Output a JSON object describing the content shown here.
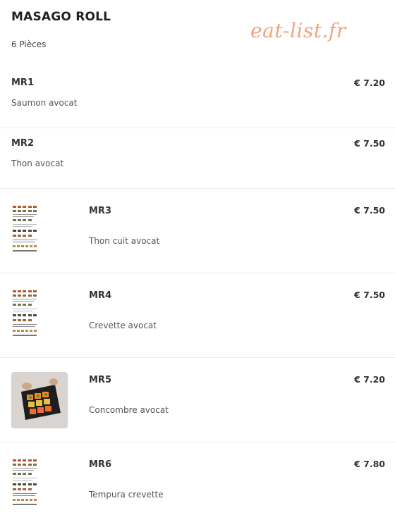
{
  "header": {
    "title": "MASAGO ROLL",
    "subtitle": "6 Pièces",
    "watermark": "eat-list.fr"
  },
  "items": [
    {
      "code": "MR1",
      "description": "Saumon avocat",
      "price": "€ 7.20",
      "image": "none"
    },
    {
      "code": "MR2",
      "description": "Thon avocat",
      "price": "€ 7.50",
      "image": "none"
    },
    {
      "code": "MR3",
      "description": "Thon cuit avocat",
      "price": "€ 7.50",
      "image": "menu-sheet"
    },
    {
      "code": "MR4",
      "description": "Crevette avocat",
      "price": "€ 7.50",
      "image": "menu-sheet"
    },
    {
      "code": "MR5",
      "description": "Concombre avocat",
      "price": "€ 7.20",
      "image": "sushi-tray-photo"
    },
    {
      "code": "MR6",
      "description": "Tempura crevette",
      "price": "€ 7.80",
      "image": "menu-sheet"
    }
  ],
  "colors": {
    "watermark": "#f0a37c",
    "divider": "#ececec",
    "text": "#333333"
  }
}
